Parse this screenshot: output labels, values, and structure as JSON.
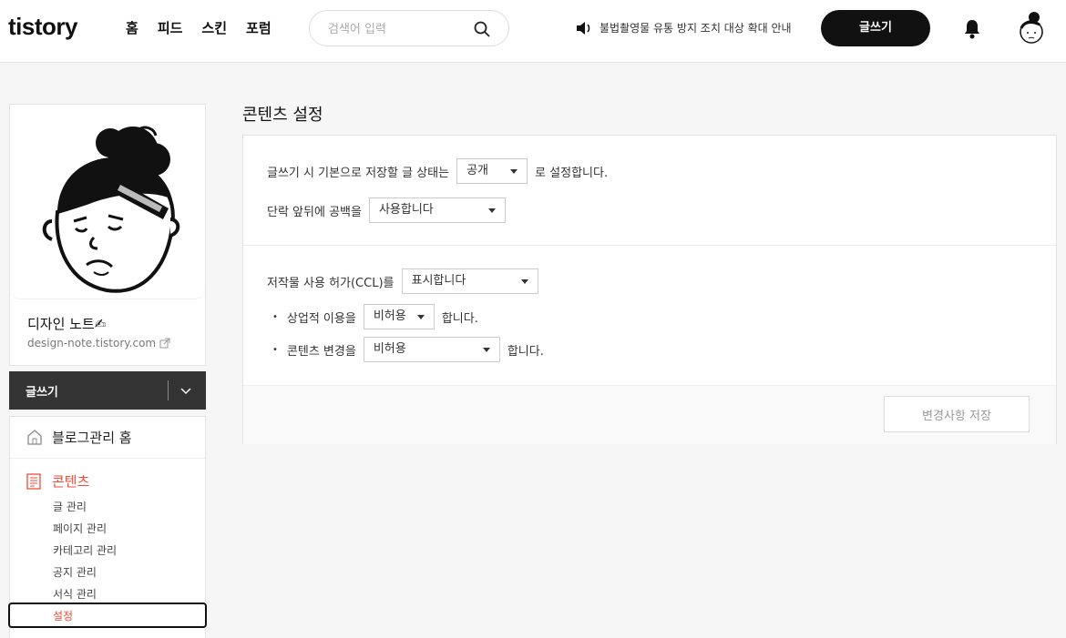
{
  "header": {
    "logo": "tistory",
    "nav": [
      "홈",
      "피드",
      "스킨",
      "포럼"
    ],
    "search_placeholder": "검색어 입력",
    "notice": "불법촬영물 유통 방지 조치 대상 확대 안내",
    "write_label": "글쓰기"
  },
  "sidebar": {
    "blog_name": "디자인 노트✍",
    "blog_url": "design-note.tistory.com",
    "write_label": "글쓰기",
    "home_label": "블로그관리 홈",
    "content_label": "콘텐츠",
    "sub_items": [
      "글 관리",
      "페이지 관리",
      "카테고리 관리",
      "공지 관리",
      "서식 관리",
      "설정"
    ]
  },
  "main": {
    "title": "콘텐츠 설정",
    "default_state_prefix": "글쓰기 시 기본으로 저장할 글 상태는",
    "default_state_value": "공개",
    "default_state_suffix": "로 설정합니다.",
    "paragraph_prefix": "단락 앞뒤에 공백을",
    "paragraph_value": "사용합니다",
    "ccl_prefix": "저작물 사용 허가(CCL)를",
    "ccl_value": "표시합니다",
    "commercial_prefix": "상업적 이용을",
    "commercial_value": "비허용",
    "commercial_suffix": "합니다.",
    "modify_prefix": "콘텐츠 변경을",
    "modify_value": "비허용",
    "modify_suffix": "합니다.",
    "save_label": "변경사항 저장"
  }
}
